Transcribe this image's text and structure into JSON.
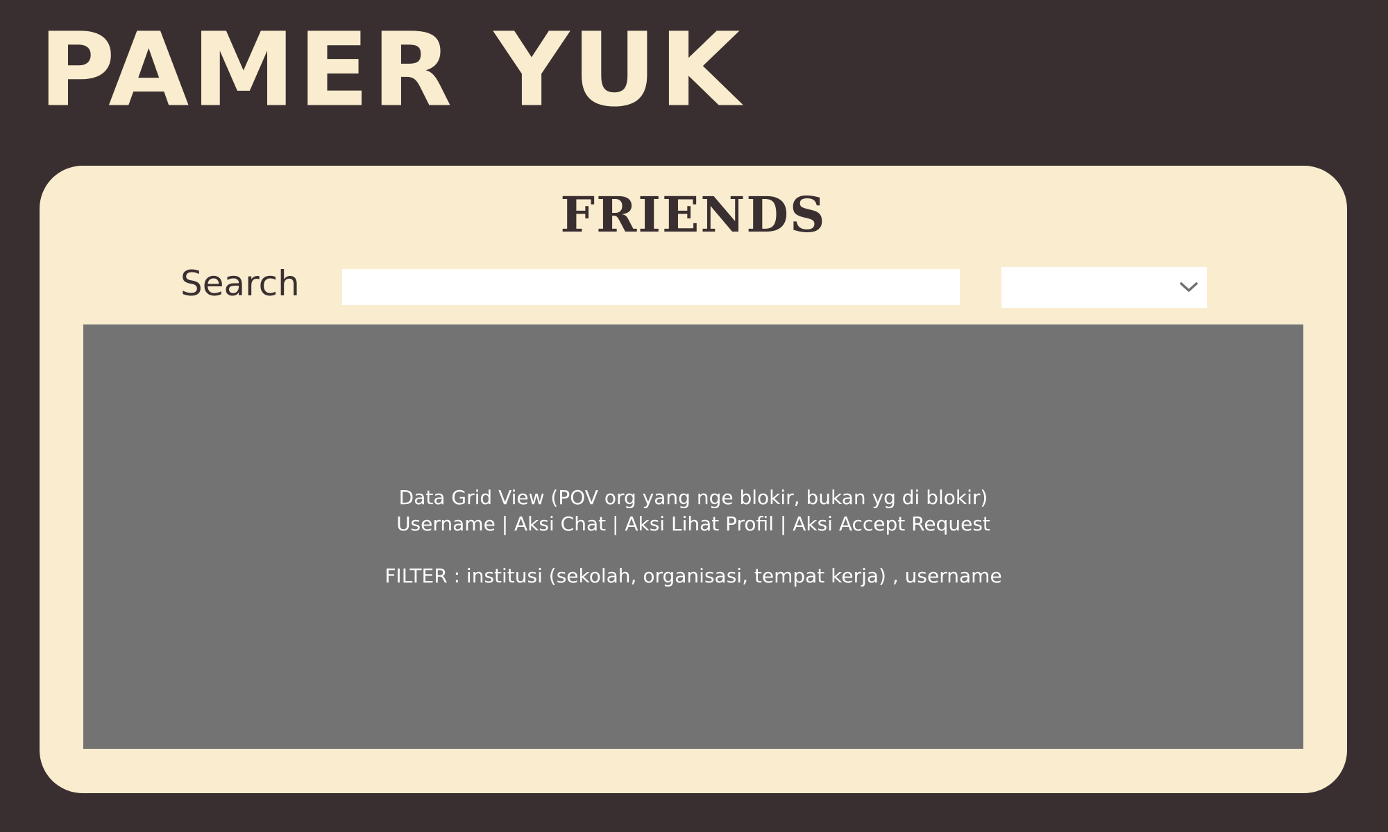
{
  "app": {
    "logo_text": "PAMER YUK"
  },
  "panel": {
    "title": "FRIENDS"
  },
  "search": {
    "label": "Search",
    "value": "",
    "placeholder": ""
  },
  "filter_dropdown": {
    "selected": "",
    "icon": "chevron-down-icon"
  },
  "data_grid": {
    "placeholder_lines": [
      "Data Grid View (POV org yang nge blokir, bukan yg di blokir)",
      "Username | Aksi Chat | Aksi Lihat Profil | Aksi Accept Request",
      "FILTER :  institusi (sekolah, organisasi, tempat kerja) , username"
    ]
  },
  "colors": {
    "background": "#3a2f30",
    "panel": "#faedcf",
    "logo": "#faedcf",
    "grid": "#737373",
    "input": "#ffffff",
    "text_dark": "#3a2f30",
    "text_light": "#ffffff"
  }
}
